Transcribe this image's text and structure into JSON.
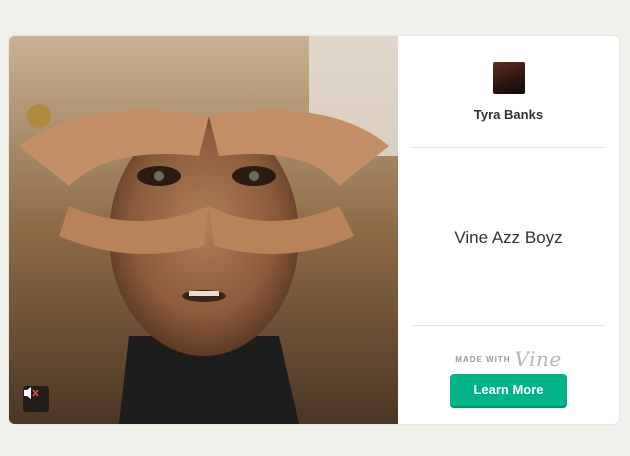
{
  "post": {
    "author_name": "Tyra Banks",
    "caption": "Vine Azz Boyz"
  },
  "branding": {
    "made_with": "MADE WITH",
    "logo_text": "Vine"
  },
  "actions": {
    "learn_more": "Learn More"
  },
  "icons": {
    "mute": "speaker-muted-icon",
    "avatar": "author-avatar"
  },
  "colors": {
    "accent": "#00b488",
    "background": "#f0f0eb"
  }
}
